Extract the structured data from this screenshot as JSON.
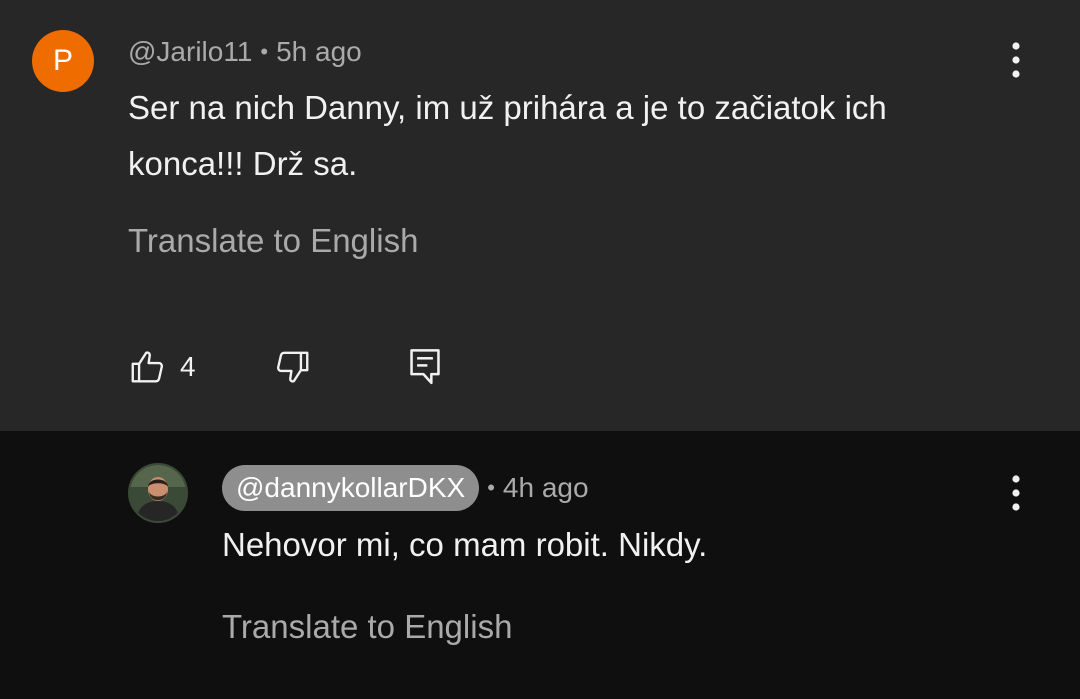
{
  "comment": {
    "avatar_letter": "P",
    "author": "@Jarilo11",
    "separator": "•",
    "time": "5h ago",
    "text": "Ser na nich Danny, im už prihára a je to začiatok ich konca!!! Drž sa.",
    "translate_label": "Translate to English",
    "like_count": "4",
    "avatar_color": "#ef6c00",
    "icons": {
      "menu": "more-vert-icon",
      "like": "thumb-up-icon",
      "dislike": "thumb-down-icon",
      "reply": "reply-icon"
    }
  },
  "reply": {
    "author": "@dannykollarDKX",
    "separator": "•",
    "time": "4h ago",
    "text": "Nehovor mi, co mam robit. Nikdy.",
    "translate_label": "Translate to English",
    "icons": {
      "menu": "more-vert-icon"
    }
  },
  "colors": {
    "main_background": "#272727",
    "reply_background": "#0f0f0f",
    "primary_text": "#f1f1f1",
    "secondary_text": "#aaaaaa",
    "owner_chip": "#8e8e8e"
  }
}
